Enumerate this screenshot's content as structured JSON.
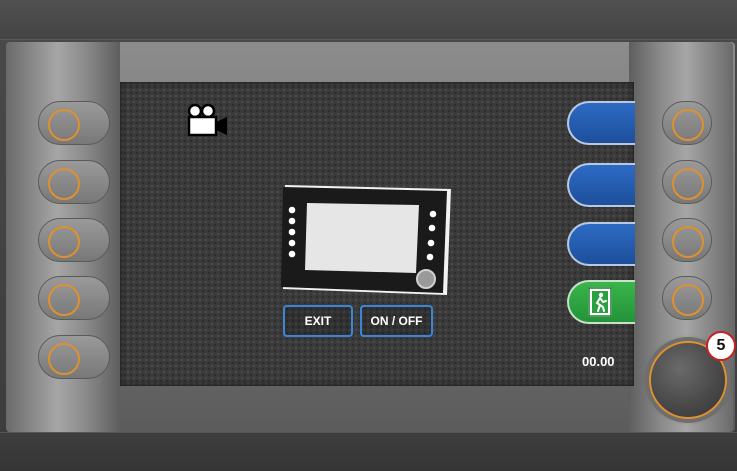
{
  "screen": {
    "buttons": {
      "exit_label": "EXIT",
      "onoff_label": "ON / OFF"
    },
    "time_readout": "00.00",
    "callout_number": "5"
  },
  "icons": {
    "camera": "video-camera-icon",
    "display": "display-panel-icon",
    "exit_sign": "emergency-exit-icon"
  },
  "colors": {
    "accent_orange": "#e0902e",
    "blue_tab": "#2d6bc3",
    "green_tab": "#3ab54a",
    "button_border": "#3a86d6",
    "callout_border": "#c82020"
  }
}
